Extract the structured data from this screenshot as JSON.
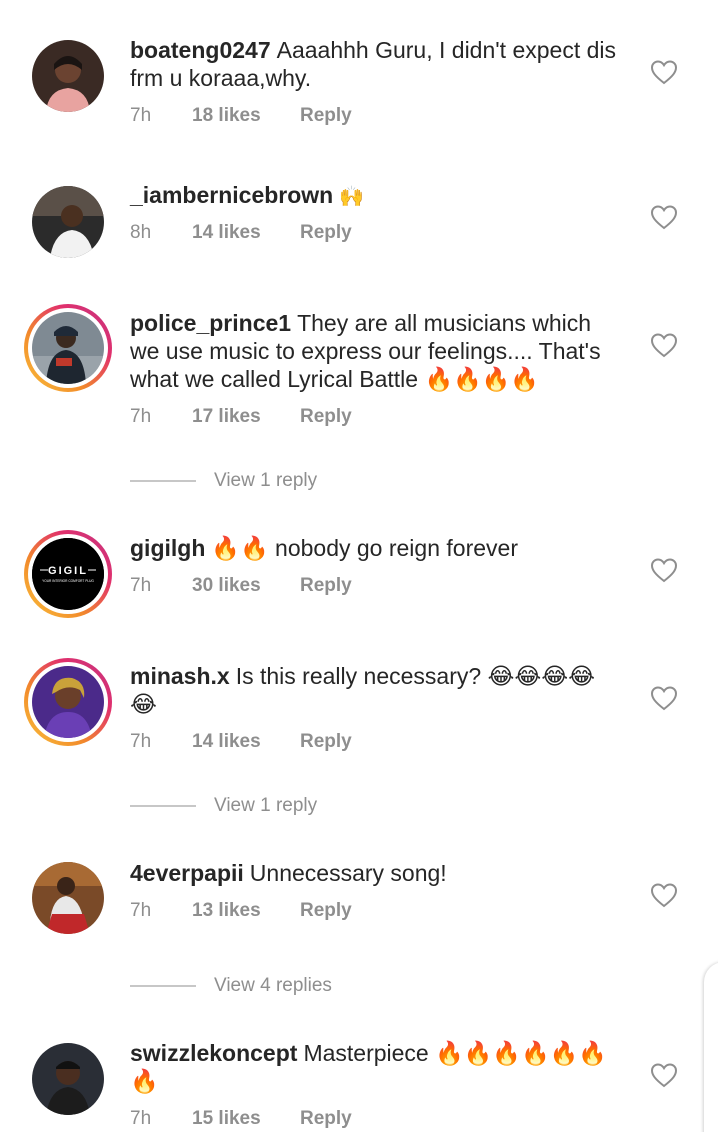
{
  "comments": [
    {
      "username": "boateng0247",
      "text_line1": "Aaaahhh Guru, I didn't expect dis",
      "text_line2": "frm u koraaa,why.",
      "time": "7h",
      "likes": "18 likes",
      "reply": "Reply"
    },
    {
      "username": "_iambernicebrown",
      "text_line1": "🙌",
      "time": "8h",
      "likes": "14 likes",
      "reply": "Reply"
    },
    {
      "username": "police_prince1",
      "text_line1": "They are all musicians which",
      "text_line2": "we use music to express our feelings.... That's",
      "text_line3": "what we called Lyrical Battle 🔥🔥🔥🔥",
      "time": "7h",
      "likes": "17 likes",
      "reply": "Reply"
    },
    {
      "username": "gigilgh",
      "text_line1": "🔥🔥 nobody go reign forever",
      "time": "7h",
      "likes": "30 likes",
      "reply": "Reply",
      "avatar_text": "GIGIL",
      "avatar_subtext": "YOUR INTERIOR COMFORT PLUG"
    },
    {
      "username": "minash.x",
      "text_line1": "Is this really necessary? 😂😂😂😂",
      "text_line2": "😂",
      "time": "7h",
      "likes": "14 likes",
      "reply": "Reply"
    },
    {
      "username": "4everpapii",
      "text_line1": "Unnecessary song!",
      "time": "7h",
      "likes": "13 likes",
      "reply": "Reply"
    },
    {
      "username": "swizzlekoncept",
      "text_line1": "Masterpiece 🔥🔥🔥🔥🔥🔥",
      "text_line2": "🔥",
      "time": "7h",
      "likes": "15 likes",
      "reply": "Reply"
    }
  ],
  "view_replies": [
    "View 1 reply",
    "View 1 reply",
    "View 4 replies"
  ],
  "icons": {
    "like": "heart-outline-icon"
  },
  "colors": {
    "meta_text": "#8e8e8e",
    "primary_text": "#262626",
    "story_ring_start": "#f9c23c",
    "story_ring_end": "#c13584"
  }
}
